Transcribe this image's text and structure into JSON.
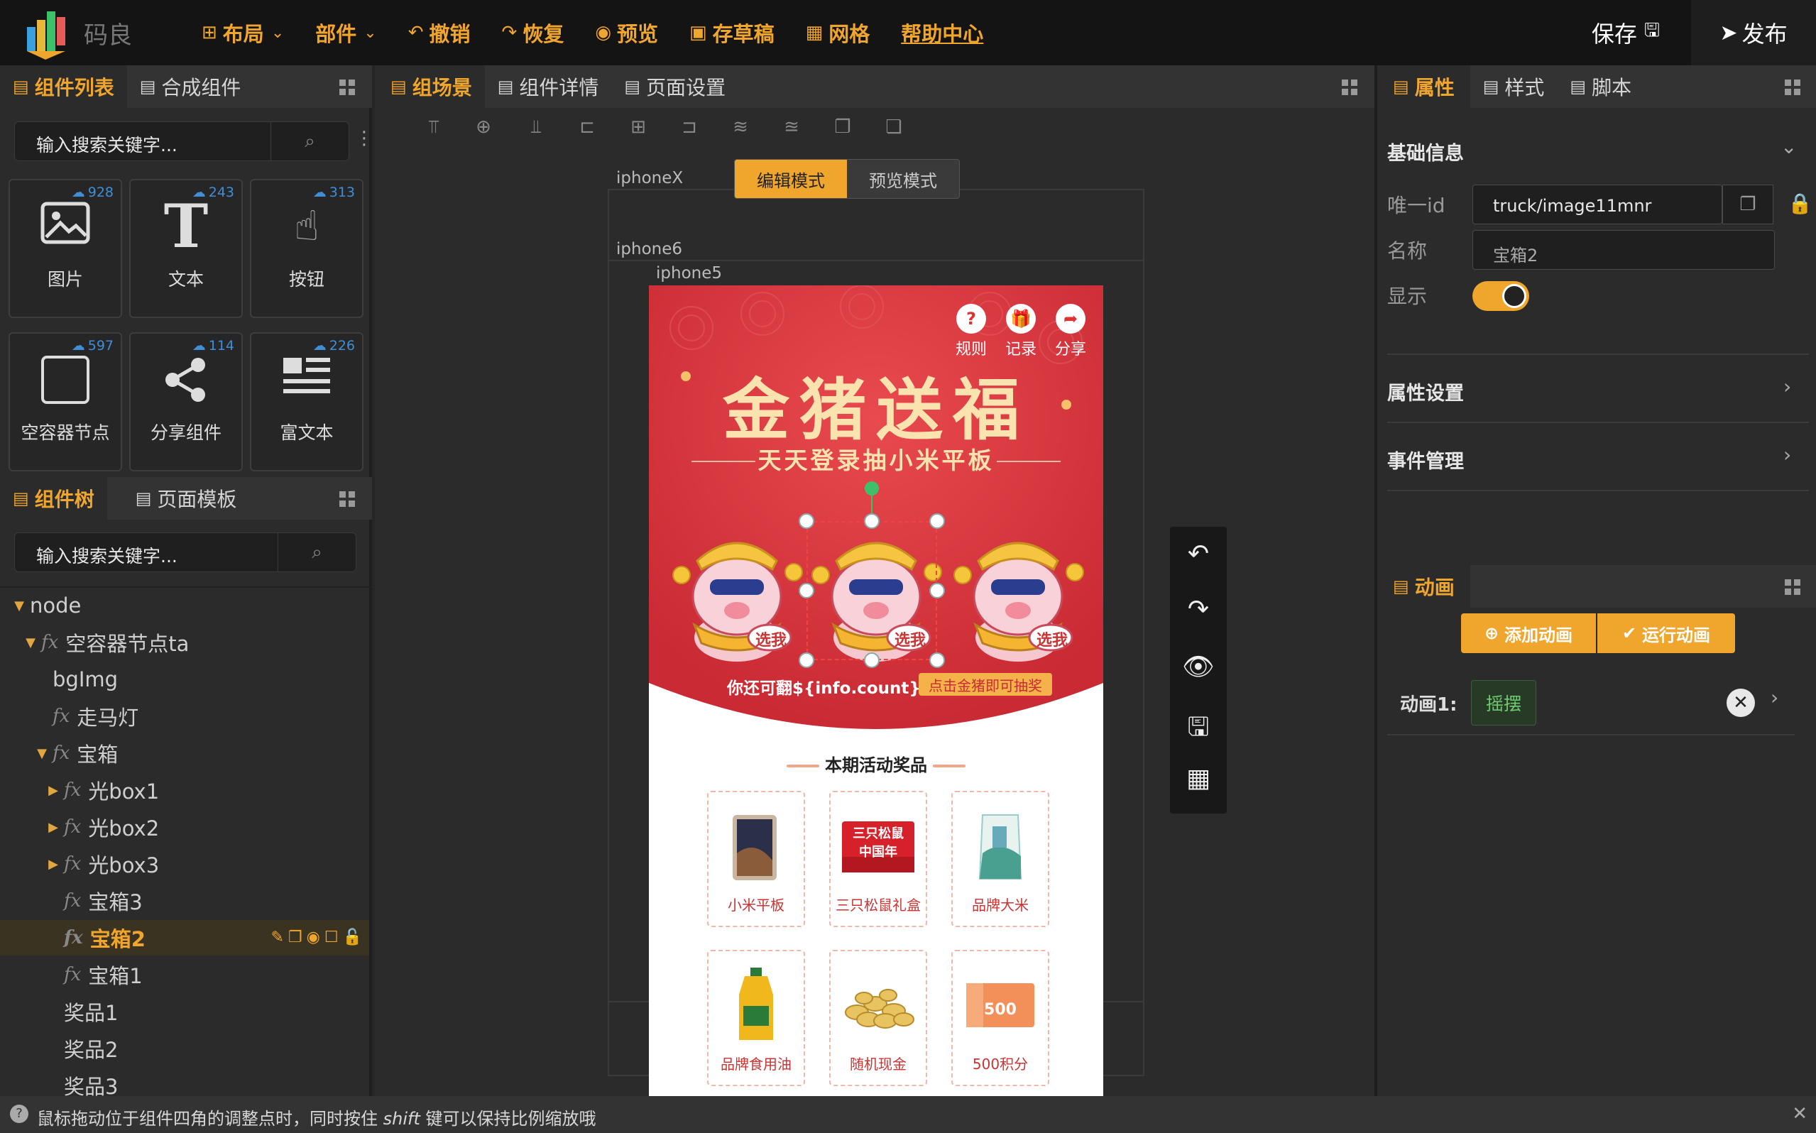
{
  "app": {
    "name": "码良",
    "menu": [
      {
        "label": "布局",
        "icon": "⊞",
        "dropdown": true
      },
      {
        "label": "部件",
        "icon": "",
        "dropdown": true
      },
      {
        "label": "撤销",
        "icon": "↶"
      },
      {
        "label": "恢复",
        "icon": "↷"
      },
      {
        "label": "预览",
        "icon": "◉"
      },
      {
        "label": "存草稿",
        "icon": "▣"
      },
      {
        "label": "网格",
        "icon": "▦"
      },
      {
        "label": "帮助中心",
        "icon": ""
      }
    ],
    "save_label": "保存",
    "publish_label": "发布"
  },
  "left": {
    "tabs": [
      "组件列表",
      "合成组件"
    ],
    "search_placeholder": "输入搜索关键字...",
    "components": [
      {
        "label": "图片",
        "count": "928"
      },
      {
        "label": "文本",
        "count": "243"
      },
      {
        "label": "按钮",
        "count": "313"
      },
      {
        "label": "空容器节点",
        "count": "597"
      },
      {
        "label": "分享组件",
        "count": "114"
      },
      {
        "label": "富文本",
        "count": "226"
      }
    ],
    "tree_tabs": [
      "组件树",
      "页面模板"
    ],
    "tree_search_placeholder": "输入搜索关键字...",
    "tree": [
      {
        "label": "node",
        "fx": false,
        "caret": "down",
        "indent": 0
      },
      {
        "label": "空容器节点ta",
        "fx": true,
        "caret": "down",
        "indent": 1
      },
      {
        "label": "bgImg",
        "fx": false,
        "caret": "",
        "indent": 2
      },
      {
        "label": "走马灯",
        "fx": true,
        "caret": "",
        "indent": 2
      },
      {
        "label": "宝箱",
        "fx": true,
        "caret": "down",
        "indent": 2
      },
      {
        "label": "光box1",
        "fx": true,
        "caret": "right",
        "indent": 3
      },
      {
        "label": "光box2",
        "fx": true,
        "caret": "right",
        "indent": 3
      },
      {
        "label": "光box3",
        "fx": true,
        "caret": "right",
        "indent": 3
      },
      {
        "label": "宝箱3",
        "fx": true,
        "caret": "",
        "indent": 3
      },
      {
        "label": "宝箱2",
        "fx": true,
        "caret": "",
        "indent": 3,
        "selected": true
      },
      {
        "label": "宝箱1",
        "fx": true,
        "caret": "",
        "indent": 3
      },
      {
        "label": "奖品1",
        "fx": false,
        "caret": "",
        "indent": 3
      },
      {
        "label": "奖品2",
        "fx": false,
        "caret": "",
        "indent": 3
      },
      {
        "label": "奖品3",
        "fx": false,
        "caret": "",
        "indent": 3
      }
    ]
  },
  "center": {
    "tabs": [
      "组场景",
      "组件详情",
      "页面设置"
    ],
    "devices": [
      "iphoneX",
      "iphone6",
      "iphone5"
    ],
    "mode_edit": "编辑模式",
    "mode_preview": "预览模式",
    "page": {
      "top_icons": [
        {
          "label": "规则",
          "glyph": "?"
        },
        {
          "label": "记录",
          "glyph": "🎁"
        },
        {
          "label": "分享",
          "glyph": "➦"
        }
      ],
      "title": "金猪送福",
      "subtitle": "天天登录抽小米平板",
      "pig_tag": "选我",
      "count_text": "你还可翻${info.count}次",
      "count_suffix": "点击金猪即可抽奖",
      "prizes_title": "本期活动奖品",
      "prizes": [
        {
          "label": "小米平板"
        },
        {
          "label": "三只松鼠礼盒",
          "badge": "三只松鼠 中国年"
        },
        {
          "label": "品牌大米"
        },
        {
          "label": "品牌食用油"
        },
        {
          "label": "随机现金"
        },
        {
          "label": "500积分",
          "badge": "500"
        }
      ]
    }
  },
  "right": {
    "tabs": [
      "属性",
      "样式",
      "脚本"
    ],
    "basic_title": "基础信息",
    "id_label": "唯一id",
    "id_value": "truck/image11mnr",
    "name_label": "名称",
    "name_value": "宝箱2",
    "show_label": "显示",
    "show_on": true,
    "attr_title": "属性设置",
    "event_title": "事件管理",
    "anim_tab": "动画",
    "add_anim": "添加动画",
    "run_anim": "运行动画",
    "anim_label": "动画1:",
    "anim_value": "摇摆"
  },
  "status": {
    "text_a": "鼠标拖动位于组件四角的调整点时，同时按住",
    "text_key": "shift",
    "text_b": "键可以保持比例缩放哦"
  },
  "colors": {
    "accent": "#f0a52c",
    "page_red": "#d9363e",
    "link_blue": "#3e8ed8"
  }
}
